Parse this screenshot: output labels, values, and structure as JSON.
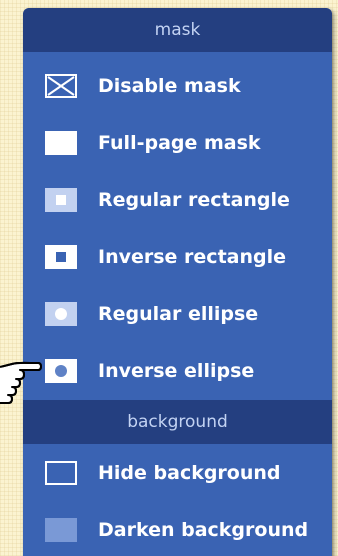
{
  "sections": {
    "mask": "mask",
    "background": "background"
  },
  "items": [
    {
      "label": "Disable mask",
      "icon": "x-box-icon"
    },
    {
      "label": "Full-page mask",
      "icon": "filled-rectangle-icon"
    },
    {
      "label": "Regular rectangle",
      "icon": "regular-rectangle-icon"
    },
    {
      "label": "Inverse rectangle",
      "icon": "inverse-rectangle-icon"
    },
    {
      "label": "Regular ellipse",
      "icon": "regular-ellipse-icon"
    },
    {
      "label": "Inverse ellipse",
      "icon": "inverse-ellipse-icon"
    },
    {
      "label": "Hide background",
      "icon": "outline-rectangle-icon"
    },
    {
      "label": "Darken background",
      "icon": "darkened-rectangle-icon"
    }
  ],
  "colors": {
    "panel": "#3a63b3",
    "header": "#243f80",
    "header_text": "#c3d3f3",
    "item_text": "#ffffff",
    "page_background": "#fbf3d0"
  }
}
